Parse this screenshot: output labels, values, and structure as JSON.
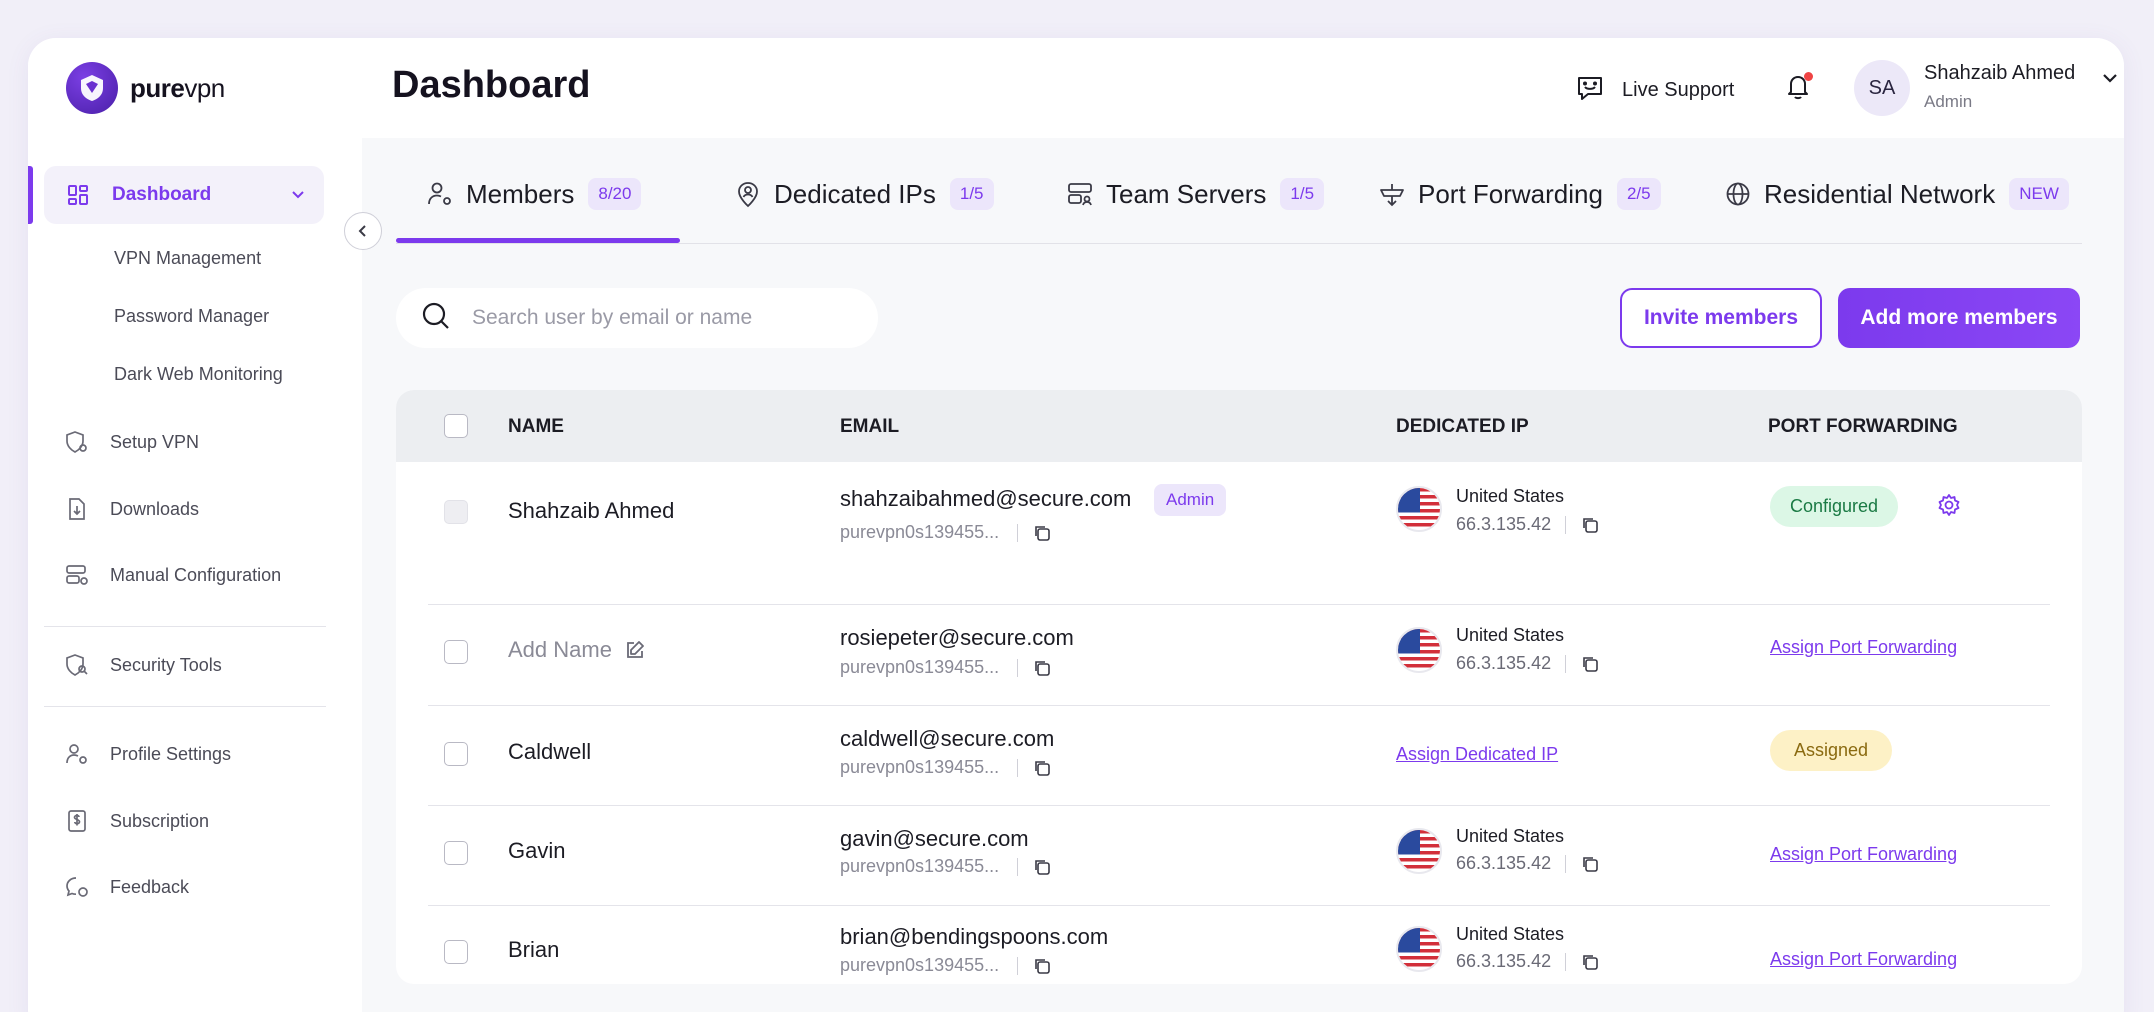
{
  "brand": {
    "name_bold": "pure",
    "name_thin": "vpn"
  },
  "sidebar": {
    "active": {
      "label": "Dashboard"
    },
    "subitems": [
      "VPN Management",
      "Password Manager",
      "Dark Web Monitoring"
    ],
    "items": [
      {
        "label": "Setup VPN",
        "icon": "shield-gear-icon"
      },
      {
        "label": "Downloads",
        "icon": "download-file-icon"
      },
      {
        "label": "Manual Configuration",
        "icon": "server-config-icon"
      },
      {
        "label": "Security Tools",
        "icon": "shield-search-icon"
      },
      {
        "label": "Profile Settings",
        "icon": "user-gear-icon"
      },
      {
        "label": "Subscription",
        "icon": "dollar-doc-icon"
      },
      {
        "label": "Feedback",
        "icon": "feedback-icon"
      }
    ]
  },
  "header": {
    "title": "Dashboard",
    "live_support": "Live Support",
    "user": {
      "initials": "SA",
      "name": "Shahzaib Ahmed",
      "role": "Admin"
    }
  },
  "tabs": [
    {
      "label": "Members",
      "badge": "8/20",
      "icon": "members-icon"
    },
    {
      "label": "Dedicated IPs",
      "badge": "1/5",
      "icon": "location-user-icon"
    },
    {
      "label": "Team Servers",
      "badge": "1/5",
      "icon": "team-server-icon"
    },
    {
      "label": "Port Forwarding",
      "badge": "2/5",
      "icon": "port-forwarding-icon"
    },
    {
      "label": "Residential Network",
      "badge": "NEW",
      "icon": "globe-icon"
    }
  ],
  "search": {
    "placeholder": "Search user by email or name"
  },
  "actions": {
    "invite": "Invite members",
    "add": "Add more members"
  },
  "table": {
    "headers": {
      "name": "NAME",
      "email": "EMAIL",
      "ip": "DEDICATED IP",
      "port": "PORT FORWARDING"
    },
    "rows": [
      {
        "name": "Shahzaib Ahmed",
        "email": "shahzaibahmed@secure.com",
        "username": "purevpn0s139455...",
        "badge": "Admin",
        "country": "United States",
        "ip": "66.3.135.42",
        "port_status": "Configured"
      },
      {
        "name": "Add Name",
        "email": "rosiepeter@secure.com",
        "username": "purevpn0s139455...",
        "country": "United States",
        "ip": "66.3.135.42",
        "port_link": "Assign Port Forwarding"
      },
      {
        "name": "Caldwell",
        "email": "caldwell@secure.com",
        "username": "purevpn0s139455...",
        "ip_link": "Assign Dedicated IP",
        "port_status": "Assigned"
      },
      {
        "name": "Gavin",
        "email": "gavin@secure.com",
        "username": "purevpn0s139455...",
        "country": "United States",
        "ip": "66.3.135.42",
        "port_link": "Assign Port Forwarding"
      },
      {
        "name": "Brian",
        "email": "brian@bendingspoons.com",
        "username": "purevpn0s139455...",
        "country": "United States",
        "ip": "66.3.135.42",
        "port_link": "Assign Port Forwarding"
      }
    ]
  },
  "colors": {
    "accent": "#7c3aed",
    "configured_bg": "#dcf7e6",
    "assigned_bg": "#fdf1c6"
  }
}
